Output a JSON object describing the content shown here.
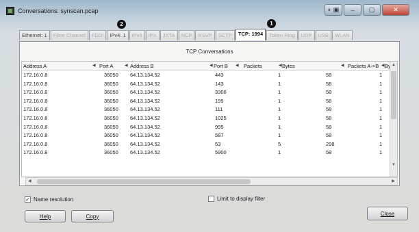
{
  "window": {
    "title": "Conversations: synscan.pcap",
    "controls": [
      "◐ ▣",
      "‒",
      "▢",
      "✕"
    ]
  },
  "markers": {
    "one": "1",
    "two": "2"
  },
  "tabs": [
    {
      "label": "Ethernet: 1",
      "state": "normal"
    },
    {
      "label": "Fibre Channel",
      "state": "dim"
    },
    {
      "label": "FDDI",
      "state": "dim"
    },
    {
      "label": "IPv4: 1",
      "state": "normal"
    },
    {
      "label": "IPv6",
      "state": "dim"
    },
    {
      "label": "IPX",
      "state": "dim"
    },
    {
      "label": "JXTA",
      "state": "dim"
    },
    {
      "label": "NCP",
      "state": "dim"
    },
    {
      "label": "RSVP",
      "state": "dim"
    },
    {
      "label": "SCTP",
      "state": "dim"
    },
    {
      "label": "TCP: 1994",
      "state": "active"
    },
    {
      "label": "Token Ring",
      "state": "dim"
    },
    {
      "label": "UDP",
      "state": "dim"
    },
    {
      "label": "USB",
      "state": "dim"
    },
    {
      "label": "WLAN",
      "state": "dim"
    }
  ],
  "panel": {
    "title": "TCP Conversations"
  },
  "table": {
    "headers": [
      "Address A",
      "Port A",
      "Address B",
      "Port B",
      "Packets",
      "Bytes",
      "Packets A->B",
      "Byt"
    ],
    "rows": [
      [
        "172.16.0.8",
        "36050",
        "64.13.134.52",
        "443",
        "1",
        "58",
        "1"
      ],
      [
        "172.16.0.8",
        "36050",
        "64.13.134.52",
        "143",
        "1",
        "58",
        "1"
      ],
      [
        "172.16.0.8",
        "36050",
        "64.13.134.52",
        "3306",
        "1",
        "58",
        "1"
      ],
      [
        "172.16.0.8",
        "36050",
        "64.13.134.52",
        "199",
        "1",
        "58",
        "1"
      ],
      [
        "172.16.0.8",
        "36050",
        "64.13.134.52",
        "111",
        "1",
        "58",
        "1"
      ],
      [
        "172.16.0.8",
        "36050",
        "64.13.134.52",
        "1025",
        "1",
        "58",
        "1"
      ],
      [
        "172.16.0.8",
        "36050",
        "64.13.134.52",
        "995",
        "1",
        "58",
        "1"
      ],
      [
        "172.16.0.8",
        "36050",
        "64.13.134.52",
        "587",
        "1",
        "58",
        "1"
      ],
      [
        "172.16.0.8",
        "36050",
        "64.13.134.52",
        "53",
        "5",
        "298",
        "1"
      ],
      [
        "172.16.0.8",
        "36050",
        "64.13.134.52",
        "5900",
        "1",
        "58",
        "1"
      ]
    ]
  },
  "options": {
    "name_resolution": {
      "label": "Name resolution",
      "checked": true
    },
    "limit_filter": {
      "label": "Limit to display filter",
      "checked": false
    }
  },
  "buttons": {
    "help": "Help",
    "copy": "Copy",
    "close": "Close"
  }
}
